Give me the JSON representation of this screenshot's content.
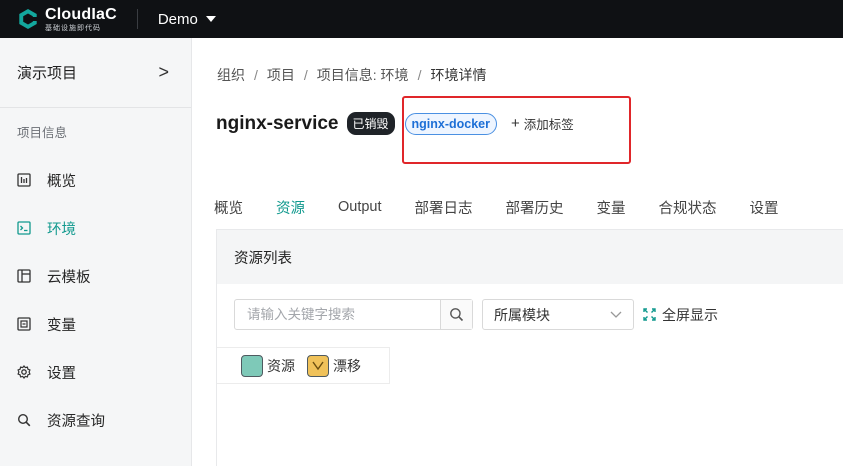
{
  "app": {
    "logo_name": "CloudIaC",
    "logo_sub": "基础设施即代码",
    "org": "Demo"
  },
  "sidebar": {
    "project": "演示项目",
    "project_chevron": ">",
    "section_title": "项目信息",
    "items": [
      {
        "label": "概览",
        "icon": "overview-icon"
      },
      {
        "label": "环境",
        "icon": "terminal-icon",
        "active": true
      },
      {
        "label": "云模板",
        "icon": "template-icon"
      },
      {
        "label": "变量",
        "icon": "variable-icon"
      },
      {
        "label": "设置",
        "icon": "gear-icon"
      },
      {
        "label": "资源查询",
        "icon": "search-icon"
      }
    ]
  },
  "breadcrumb": [
    "组织",
    "项目",
    "项目信息: 环境",
    "环境详情"
  ],
  "breadcrumb_sep": "/",
  "env": {
    "title": "nginx-service",
    "status": "已销毁",
    "tag": "nginx-docker",
    "add_tag_label": "添加标签"
  },
  "tabs": [
    "概览",
    "资源",
    "Output",
    "部署日志",
    "部署历史",
    "变量",
    "合规状态",
    "设置"
  ],
  "active_tab": "资源",
  "resources": {
    "panel_title": "资源列表",
    "search_placeholder": "请输入关键字搜索",
    "module_select": "所属模块",
    "fullscreen_label": "全屏显示",
    "legend": [
      {
        "label": "资源",
        "color": "#7ec9b8"
      },
      {
        "label": "漂移",
        "color": "#f0c25a"
      }
    ]
  },
  "colors": {
    "accent": "#11998e",
    "highlight": "#e0262a",
    "topbar": "#0f1114"
  }
}
